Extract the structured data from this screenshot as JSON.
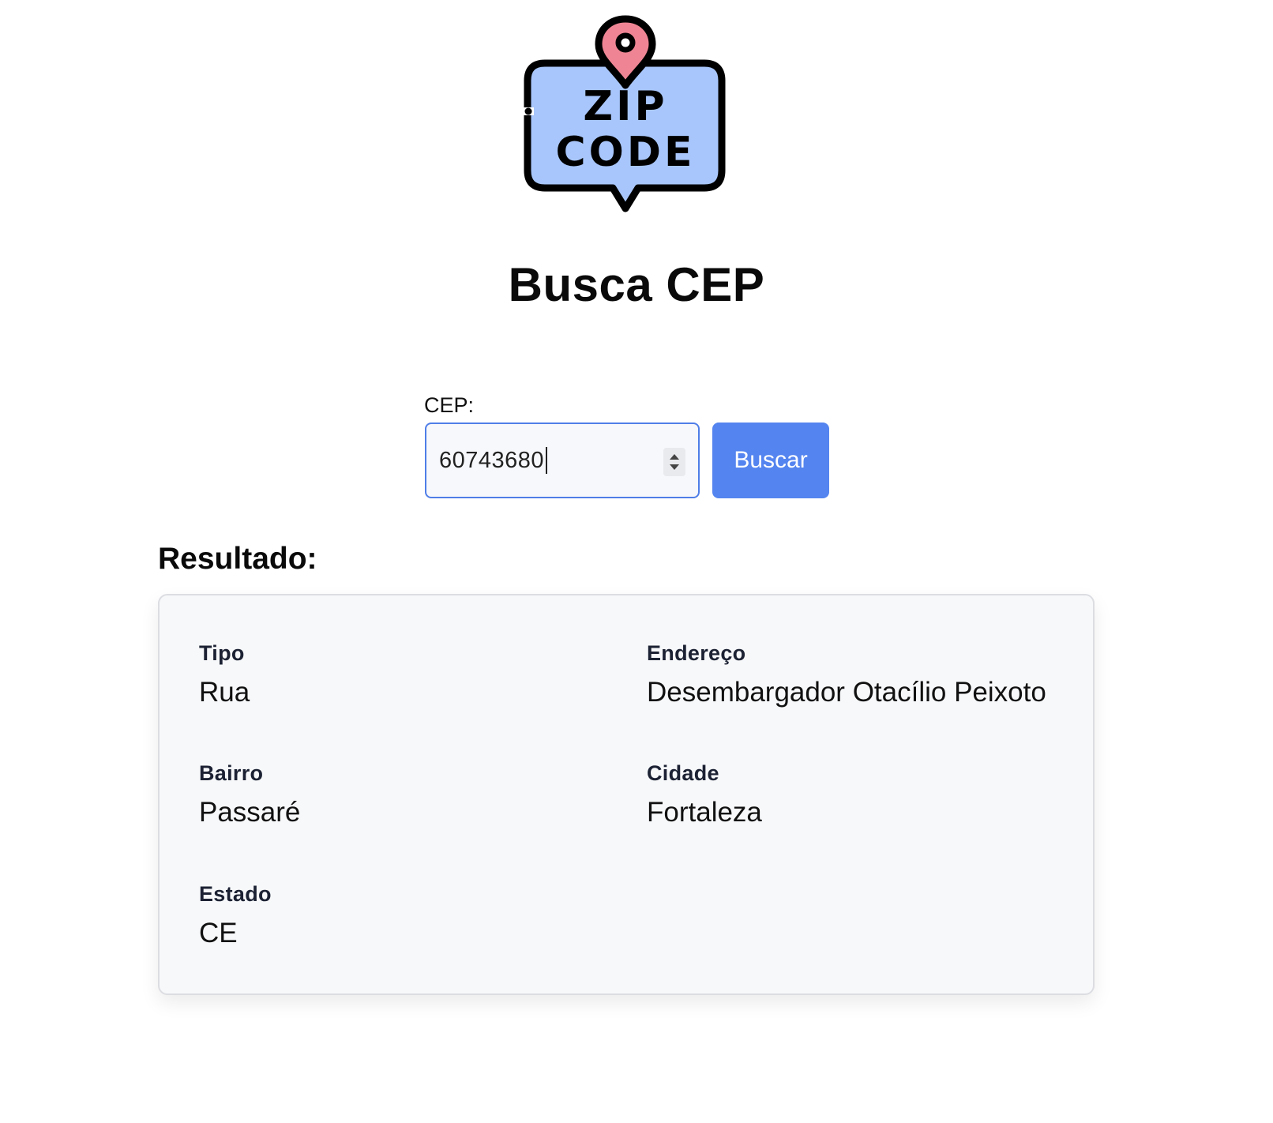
{
  "logo": {
    "line1": "ZIP",
    "line2": "CODE"
  },
  "page_title": "Busca CEP",
  "form": {
    "cep_label": "CEP:",
    "cep_value": "60743680",
    "search_button": "Buscar"
  },
  "result": {
    "heading": "Resultado:",
    "fields": [
      {
        "label": "Tipo",
        "value": "Rua"
      },
      {
        "label": "Endereço",
        "value": "Desembargador Otacílio Peixoto"
      },
      {
        "label": "Bairro",
        "value": "Passaré"
      },
      {
        "label": "Cidade",
        "value": "Fortaleza"
      },
      {
        "label": "Estado",
        "value": "CE"
      }
    ]
  },
  "colors": {
    "accent": "#5484ef",
    "input_border": "#4f7ee8",
    "logo_bubble": "#a8c6fb",
    "logo_pin": "#ef8594",
    "card_bg": "#f7f8fa"
  }
}
